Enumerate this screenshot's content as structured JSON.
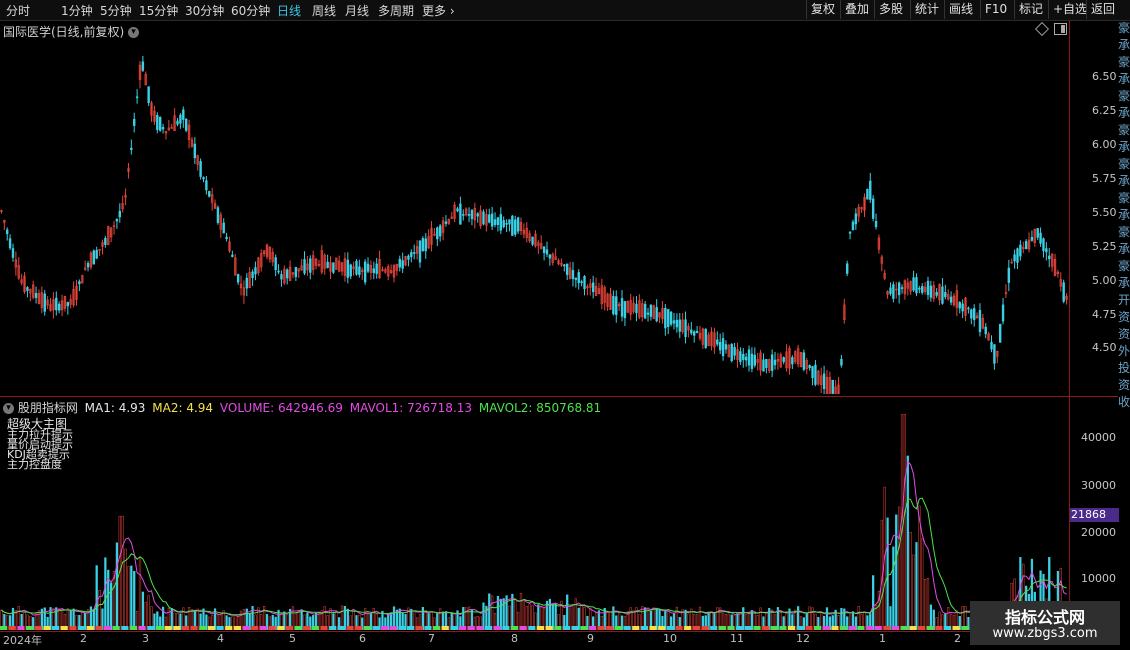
{
  "toolbar": {
    "periods": [
      "分时",
      "1分钟",
      "5分钟",
      "15分钟",
      "30分钟",
      "60分钟",
      "日线",
      "周线",
      "月线",
      "多周期",
      "更多"
    ],
    "active_period": "日线",
    "more_arrow": "›",
    "right_buttons": [
      "复权",
      "叠加",
      "多股",
      "统计",
      "画线",
      "F10",
      "标记",
      "+自选",
      "返回"
    ]
  },
  "main_chart": {
    "title": "国际医学(日线,前复权)",
    "price_ticks": [
      "6.50",
      "6.25",
      "6.00",
      "5.75",
      "5.50",
      "5.25",
      "5.00",
      "4.75",
      "4.50"
    ]
  },
  "indicator": {
    "name": "股朋指标网",
    "ma1": "MA1: 4.93",
    "ma2": "MA2: 4.94",
    "volume": "VOLUME: 642946.69",
    "mavol1": "MAVOL1: 726718.13",
    "mavol2": "MAVOL2: 850768.81",
    "overlay_lines": [
      "超级大主图",
      "主力拉升提示",
      "量价启动提示",
      "KDJ超卖提示",
      "主力控盘度"
    ],
    "vol_ticks": [
      "40000",
      "30000",
      "20000",
      "10000"
    ],
    "cursor_value": "21868",
    "colors": {
      "ma1": "#e6e6e6",
      "ma2": "#f3e24a",
      "volume": "#e34ce3",
      "mavol1": "#e34ce3",
      "mavol2": "#4ee24e",
      "cursor_bg": "#4a2a8a"
    }
  },
  "x_axis": {
    "labels": [
      "2024年",
      "2",
      "3",
      "4",
      "5",
      "6",
      "7",
      "8",
      "9",
      "10",
      "11",
      "12",
      "1",
      "2"
    ]
  },
  "chart_data": {
    "type": "candlestick",
    "price_range": [
      4.3,
      6.75
    ],
    "volume_range": [
      0,
      45000
    ],
    "peak_high": 6.72,
    "low_point": 4.32
  },
  "watermark": {
    "line1": "指标公式网",
    "line2": "www.zbgs3.com"
  },
  "right_column_text": "豪承豪承豪承豪承豪承豪承豪承豪承开资资外投资收"
}
